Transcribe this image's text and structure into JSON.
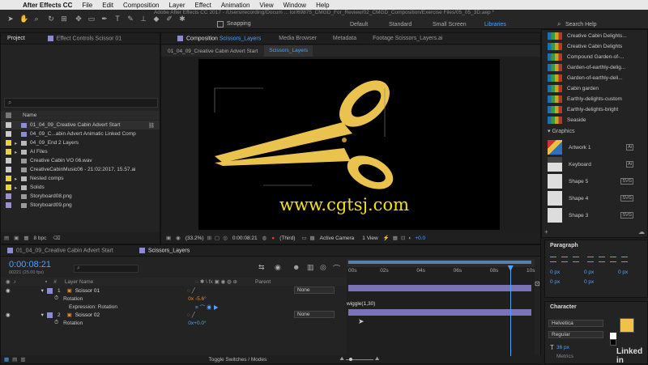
{
  "menubar": {
    "app": "After Effects CC",
    "items": [
      "File",
      "Edit",
      "Composition",
      "Layer",
      "Effect",
      "Animation",
      "View",
      "Window",
      "Help"
    ]
  },
  "title_bar": "Adobe After Effects CC 2017 - /Users/recording/Docum ... lor/69875_CMGD_For_Review/02_CMGD_Composition/Exercise Files/05_05_3D.aep *",
  "toolbar": {
    "snapping": "Snapping",
    "workspaces": [
      "Default",
      "Standard",
      "Small Screen",
      "Libraries"
    ],
    "active_workspace": "Libraries",
    "search": "Search Help"
  },
  "project": {
    "tab": "Project",
    "effect_controls": "Effect Controls Scissor 01",
    "column_name": "Name",
    "bpc": "8 bpc",
    "items": [
      {
        "name": "01_04_09_Creative Cabin Advert Start",
        "color": "#c9c9c9",
        "type": "comp"
      },
      {
        "name": "04_09_C...abin Advert Animatic Linked Comp",
        "color": "#c9c9c9",
        "type": "comp"
      },
      {
        "name": "04_09_End 2 Layers",
        "color": "#e7d43a",
        "type": "folder"
      },
      {
        "name": "AI Files",
        "color": "#e7d43a",
        "type": "folder"
      },
      {
        "name": "Creative Cabin VO 06.wav",
        "color": "#c9c9c9",
        "type": "file"
      },
      {
        "name": "CreativeCabinMusic06 - 21:02:2017, 15.57.ai",
        "color": "#c9c9c9",
        "type": "file"
      },
      {
        "name": "Nested comps",
        "color": "#e7d43a",
        "type": "folder"
      },
      {
        "name": "Solids",
        "color": "#e7d43a",
        "type": "folder"
      },
      {
        "name": "Storyboard08.png",
        "color": "#9b8fd0",
        "type": "file"
      },
      {
        "name": "Storyboard09.png",
        "color": "#9b8fd0",
        "type": "file"
      }
    ]
  },
  "composition": {
    "tab_prefix": "Composition",
    "tab_name": "Scissors_Layers",
    "other_tabs": [
      "Media Browser",
      "Metadata",
      "Footage Scissors_Layers.ai"
    ],
    "breadcrumbs": [
      "01_04_09_Creative Cabin Advert Start",
      "Scissors_Layers"
    ],
    "watermark": "www.cgtsj.com",
    "zoom": "(33.2%)",
    "timecode": "0:00:08:21",
    "resolution": "(Third)",
    "camera": "Active Camera",
    "views": "1 View",
    "exposure": "+0.0"
  },
  "timeline": {
    "tabs": [
      "01_04_09_Creative Cabin Advert Start",
      "Scissors_Layers"
    ],
    "active_tab": "Scissors_Layers",
    "timecode": "0:00:08:21",
    "frame_info": "00221 (25.00 fps)",
    "col_num": "#",
    "col_layer": "Layer Name",
    "col_parent": "Parent",
    "ruler": [
      "00s",
      "02s",
      "04s",
      "06s",
      "08s",
      "10s"
    ],
    "playhead": 0.884,
    "toggle": "Toggle Switches / Modes",
    "layers": [
      {
        "num": "1",
        "name": "Scissor 01",
        "parent": "None",
        "color": "#8c8cd6"
      },
      {
        "num": "2",
        "name": "Scissor 02",
        "parent": "None",
        "color": "#8c8cd6"
      }
    ],
    "rotation_label": "Rotation",
    "rotation_1": "0x -5.6°",
    "expression_label": "Expression: Rotation",
    "expression": "wiggle(1,30)",
    "rotation_2": "0x+0.0°"
  },
  "libraries": {
    "items": [
      "Creative Cabin Delights...",
      "Creative Cabin Delights",
      "Compound Garden-of-...",
      "Garden-of-earthly-delig...",
      "Garden-of-earthly-deli...",
      "Cabin garden",
      "Earthly-delights-custom",
      "Earthly-delights-bright",
      "Seaside"
    ],
    "graphics_label": "Graphics",
    "graphics": [
      {
        "name": "Artwork 1",
        "badge": "Ai"
      },
      {
        "name": "Keyboard",
        "badge": "Ai"
      },
      {
        "name": "Shape 5",
        "badge": "SVG"
      },
      {
        "name": "Shape 4",
        "badge": "SVG"
      },
      {
        "name": "Shape 3",
        "badge": "SVG"
      }
    ]
  },
  "paragraph": {
    "title": "Paragraph",
    "indent": [
      "0 px",
      "0 px",
      "0 px",
      "0 px",
      "0 px"
    ]
  },
  "character": {
    "title": "Character",
    "font": "Helvetica",
    "style": "Regular",
    "size": "36 px",
    "metrics": "Metrics",
    "fill_color": "#f0c24a"
  },
  "brand": "Linked in"
}
